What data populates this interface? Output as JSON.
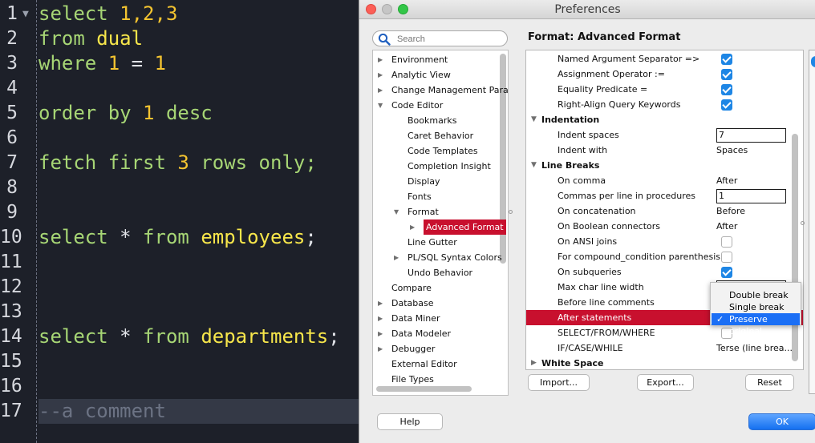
{
  "editor": {
    "line_numbers": [
      "1",
      "2",
      "3",
      "4",
      "5",
      "6",
      "7",
      "8",
      "9",
      "10",
      "11",
      "12",
      "13",
      "14",
      "15",
      "16",
      "17"
    ],
    "lines": [
      [
        {
          "text": "select ",
          "cls": "k"
        },
        {
          "text": "1,2,3",
          "cls": "n"
        }
      ],
      [
        {
          "text": "from ",
          "cls": "k"
        },
        {
          "text": "dual",
          "cls": "t"
        }
      ],
      [
        {
          "text": "where ",
          "cls": "k"
        },
        {
          "text": "1",
          "cls": "n"
        },
        {
          "text": " = ",
          "cls": "p"
        },
        {
          "text": "1",
          "cls": "n"
        }
      ],
      [],
      [
        {
          "text": "order by ",
          "cls": "k"
        },
        {
          "text": "1",
          "cls": "n"
        },
        {
          "text": " desc",
          "cls": "k"
        }
      ],
      [],
      [
        {
          "text": "fetch first ",
          "cls": "k"
        },
        {
          "text": "3",
          "cls": "n"
        },
        {
          "text": " rows only;",
          "cls": "k"
        }
      ],
      [],
      [],
      [
        {
          "text": "select ",
          "cls": "k"
        },
        {
          "text": "*",
          "cls": "p"
        },
        {
          "text": " from ",
          "cls": "k"
        },
        {
          "text": "employees",
          "cls": "t"
        },
        {
          "text": ";",
          "cls": "p"
        }
      ],
      [],
      [],
      [],
      [
        {
          "text": "select ",
          "cls": "k"
        },
        {
          "text": "*",
          "cls": "p"
        },
        {
          "text": " from ",
          "cls": "k"
        },
        {
          "text": "departments",
          "cls": "t"
        },
        {
          "text": ";",
          "cls": "p"
        }
      ],
      [],
      [],
      [
        {
          "text": "--a comment",
          "cls": "c"
        }
      ]
    ]
  },
  "dialog": {
    "title": "Preferences",
    "search_placeholder": "Search",
    "panel_title": "Format: Advanced Format",
    "tree": [
      {
        "label": "Environment",
        "level": 0,
        "toggle": "collapsed"
      },
      {
        "label": "Analytic View",
        "level": 0,
        "toggle": "collapsed"
      },
      {
        "label": "Change Management Para",
        "level": 0,
        "toggle": "collapsed"
      },
      {
        "label": "Code Editor",
        "level": 0,
        "toggle": "expanded"
      },
      {
        "label": "Bookmarks",
        "level": 1,
        "toggle": "none"
      },
      {
        "label": "Caret Behavior",
        "level": 1,
        "toggle": "none"
      },
      {
        "label": "Code Templates",
        "level": 1,
        "toggle": "none"
      },
      {
        "label": "Completion Insight",
        "level": 1,
        "toggle": "none"
      },
      {
        "label": "Display",
        "level": 1,
        "toggle": "none"
      },
      {
        "label": "Fonts",
        "level": 1,
        "toggle": "none"
      },
      {
        "label": "Format",
        "level": 1,
        "toggle": "expanded"
      },
      {
        "label": "Advanced Format",
        "level": 2,
        "toggle": "collapsed",
        "selected": true
      },
      {
        "label": "Line Gutter",
        "level": 1,
        "toggle": "none"
      },
      {
        "label": "PL/SQL Syntax Colors",
        "level": 1,
        "toggle": "collapsed"
      },
      {
        "label": "Undo Behavior",
        "level": 1,
        "toggle": "none"
      },
      {
        "label": "Compare",
        "level": 0,
        "toggle": "none"
      },
      {
        "label": "Database",
        "level": 0,
        "toggle": "collapsed"
      },
      {
        "label": "Data Miner",
        "level": 0,
        "toggle": "collapsed"
      },
      {
        "label": "Data Modeler",
        "level": 0,
        "toggle": "collapsed"
      },
      {
        "label": "Debugger",
        "level": 0,
        "toggle": "collapsed"
      },
      {
        "label": "External Editor",
        "level": 0,
        "toggle": "none"
      },
      {
        "label": "File Types",
        "level": 0,
        "toggle": "none"
      }
    ],
    "settings": [
      {
        "label": "Named Argument Separator =>",
        "type": "check",
        "checked": true
      },
      {
        "label": "Assignment Operator :=",
        "type": "check",
        "checked": true
      },
      {
        "label": "Equality Predicate =",
        "type": "check",
        "checked": true
      },
      {
        "label": "Right-Align Query Keywords",
        "type": "check",
        "checked": true
      },
      {
        "label": "Indentation",
        "type": "section"
      },
      {
        "label": "Indent spaces",
        "type": "input",
        "value": "7"
      },
      {
        "label": "Indent with",
        "type": "text",
        "value": "Spaces"
      },
      {
        "label": "Line Breaks",
        "type": "section"
      },
      {
        "label": "On comma",
        "type": "text",
        "value": "After"
      },
      {
        "label": "Commas per line in procedures",
        "type": "input",
        "value": "1"
      },
      {
        "label": "On concatenation",
        "type": "text",
        "value": "Before"
      },
      {
        "label": "On Boolean connectors",
        "type": "text",
        "value": "After"
      },
      {
        "label": "On ANSI joins",
        "type": "check",
        "checked": false
      },
      {
        "label": "For compound_condition parenthesis",
        "type": "check",
        "checked": false
      },
      {
        "label": "On subqueries",
        "type": "check",
        "checked": true
      },
      {
        "label": "Max char line width",
        "type": "input",
        "value": ""
      },
      {
        "label": "Before line comments",
        "type": "text",
        "value": ""
      },
      {
        "label": "After statements",
        "type": "text",
        "value": "",
        "highlight": true
      },
      {
        "label": "SELECT/FROM/WHERE",
        "type": "check",
        "checked": false
      },
      {
        "label": "IF/CASE/WHILE",
        "type": "text",
        "value": "Terse (line brea..."
      },
      {
        "label": "White Space",
        "type": "section"
      }
    ],
    "dropdown": {
      "options": [
        "Double break",
        "Single break",
        "Preserve original"
      ],
      "selected": "Preserve original",
      "check": "✓"
    },
    "buttons": {
      "import": "Import...",
      "export": "Export...",
      "reset": "Reset",
      "help": "Help",
      "ok": "OK"
    }
  },
  "colors": {
    "editor_bg": "#1d2029",
    "keyword": "#a7d675",
    "number": "#f4c430",
    "identifier": "#f7e64b",
    "comment": "#6c7384",
    "selection_red": "#c8102e",
    "checkbox_blue": "#1e86e5",
    "ok_blue": "#1570f0"
  }
}
